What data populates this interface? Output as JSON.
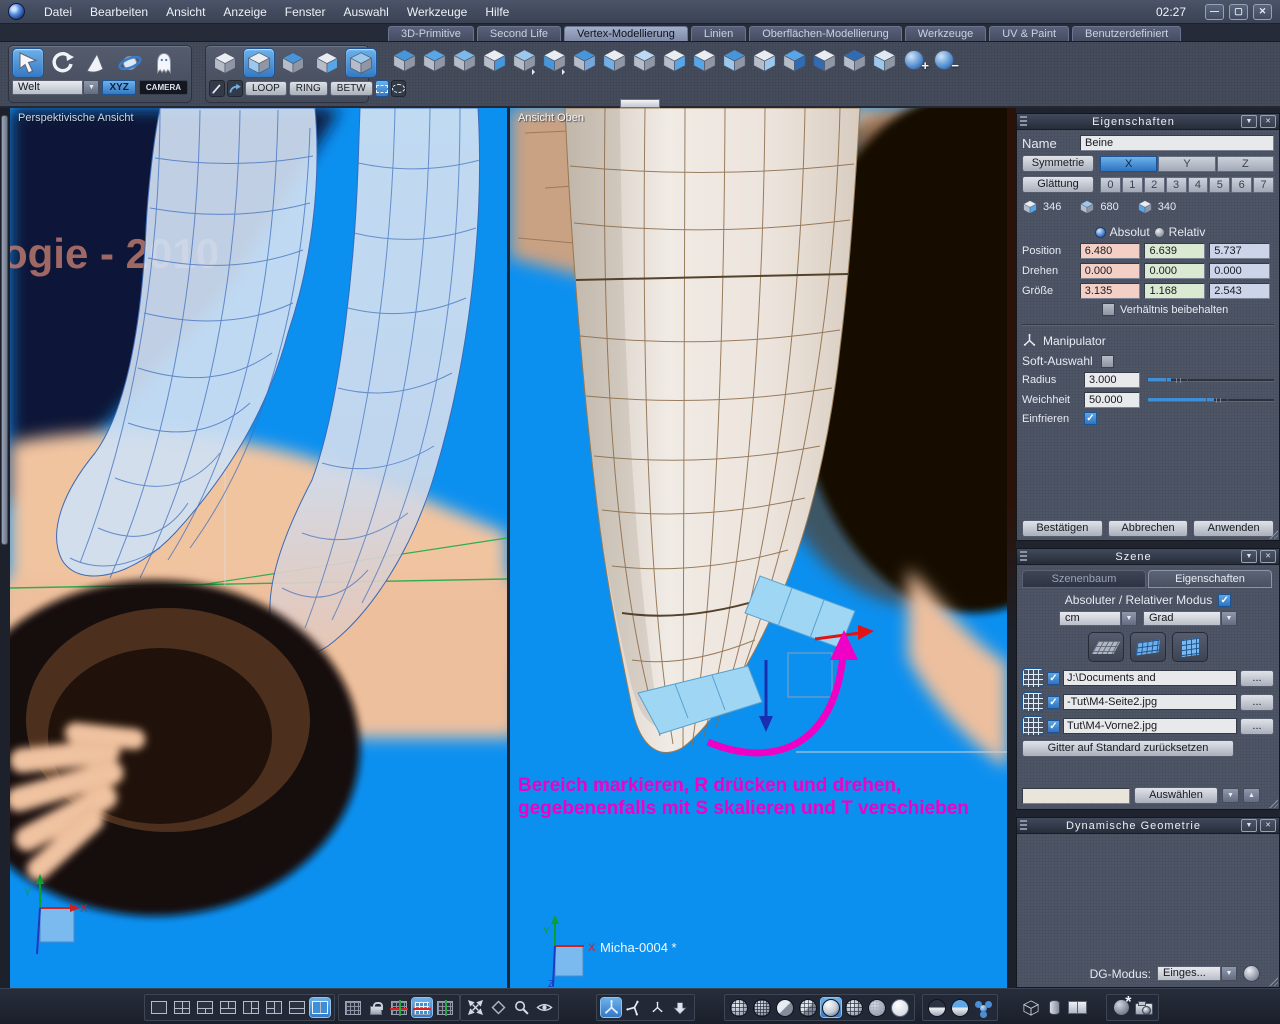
{
  "colors": {
    "accent_blue": "#3f8fd6",
    "viewport_blue": "#0c90f0",
    "annotation_magenta": "#ee00c4",
    "field_x": "#f3cfc5",
    "field_y": "#d9e9d2",
    "field_z": "#ccd4ea"
  },
  "icons": {
    "dropdown": "▼",
    "up": "▲",
    "close": "✕",
    "check": "✓",
    "minimize": "—",
    "maximize": "▢",
    "plus": "+",
    "minus": "−"
  },
  "window": {
    "clock": "02:27"
  },
  "menu": {
    "items": [
      "Datei",
      "Bearbeiten",
      "Ansicht",
      "Anzeige",
      "Fenster",
      "Auswahl",
      "Werkzeuge",
      "Hilfe"
    ]
  },
  "tabs": [
    "3D-Primitive",
    "Second Life",
    "Vertex-Modellierung",
    "Linien",
    "Oberflächen-Modellierung",
    "Werkzeuge",
    "UV & Paint",
    "Benutzerdefiniert"
  ],
  "tools": {
    "world_selector": "Welt",
    "xyz": "XYZ",
    "camera": "CAMERA",
    "loop": "LOOP",
    "ring": "RING",
    "betw": "BETW"
  },
  "viewport_left": {
    "label": "Perspektivische Ansicht",
    "watermark": "ogie - 2010"
  },
  "viewport_top": {
    "label": "Ansicht Oben",
    "hint_line1": "Bereich markieren, R drücken und drehen,",
    "hint_line2": "gegebenenfalls mit S skalieren und T verschieben",
    "object_label": "Micha-0004 *",
    "axis_x": "X",
    "axis_y": "Y",
    "axis_z": "Z"
  },
  "properties": {
    "title": "Eigenschaften",
    "name_label": "Name",
    "name_value": "Beine",
    "symmetry_label": "Symmetrie",
    "axes": [
      "X",
      "Y",
      "Z"
    ],
    "smoothing_label": "Glättung",
    "levels": [
      "0",
      "1",
      "2",
      "3",
      "4",
      "5",
      "6",
      "7"
    ],
    "points_count": "346",
    "edges_count": "680",
    "faces_count": "340",
    "absolute": "Absolut",
    "relative": "Relativ",
    "position_label": "Position",
    "rotate_label": "Drehen",
    "size_label": "Größe",
    "position": {
      "x": "6.480",
      "y": "6.639",
      "z": "5.737"
    },
    "rotation": {
      "x": "0.000",
      "y": "0.000",
      "z": "0.000"
    },
    "size": {
      "x": "3.135",
      "y": "1.168",
      "z": "2.543"
    },
    "keep_ratio": "Verhältnis beibehalten",
    "manipulator": "Manipulator",
    "soft_selection": "Soft-Auswahl",
    "radius_label": "Radius",
    "radius_value": "3.000",
    "softness_label": "Weichheit",
    "softness_value": "50.000",
    "freeze_label": "Einfrieren",
    "confirm": "Bestätigen",
    "cancel": "Abbrechen",
    "apply": "Anwenden"
  },
  "scene": {
    "title": "Szene",
    "tab_tree": "Szenenbaum",
    "tab_props": "Eigenschaften",
    "mode_label": "Absoluter / Relativer Modus",
    "unit": "cm",
    "angle": "Grad",
    "files": [
      "J:\\Documents and",
      "-Tut\\M4-Seite2.jpg",
      "Tut\\M4-Vorne2.jpg"
    ],
    "browse": "...",
    "reset_grid": "Gitter auf Standard zurücksetzen",
    "select": "Auswählen"
  },
  "dg": {
    "title": "Dynamische Geometrie",
    "mode_label": "DG-Modus:",
    "mode_value": "Einges..."
  }
}
